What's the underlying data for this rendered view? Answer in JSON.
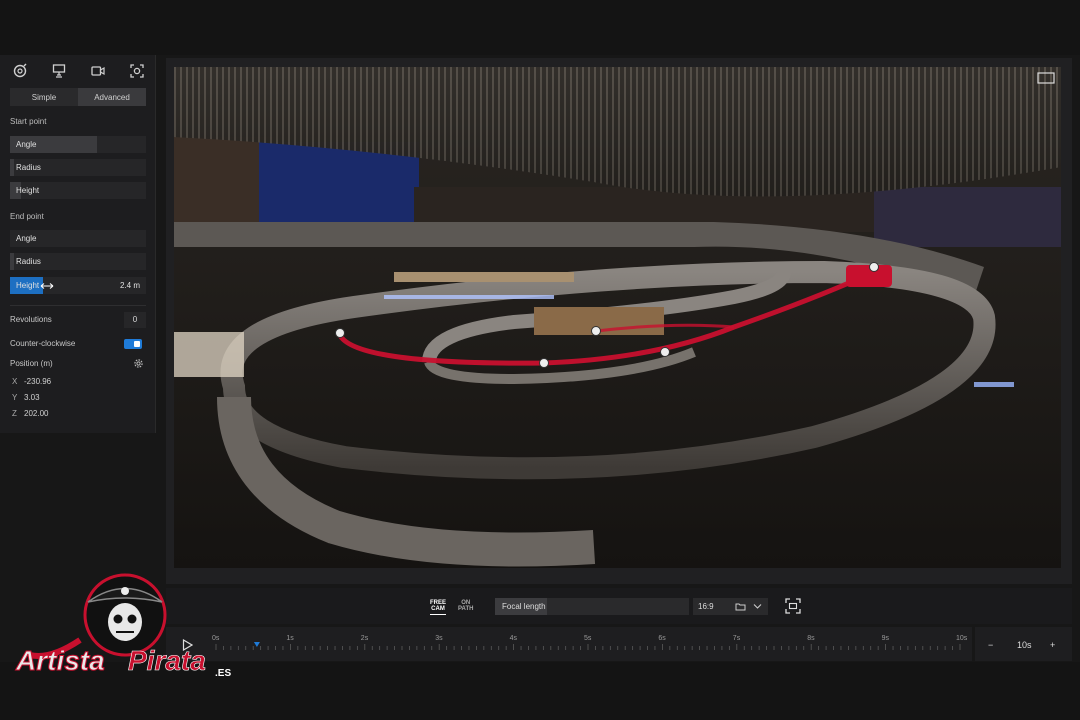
{
  "panel": {
    "icons": [
      "orbit-icon",
      "presentation-icon",
      "video-camera-icon",
      "screenshot-icon"
    ],
    "tabs": {
      "simple": "Simple",
      "advanced": "Advanced"
    },
    "start_point": {
      "label": "Start point",
      "angle": {
        "label": "Angle",
        "fill": 0.64
      },
      "radius": {
        "label": "Radius",
        "fill": 0.03
      },
      "height": {
        "label": "Height",
        "fill": 0.08
      }
    },
    "end_point": {
      "label": "End point",
      "angle": {
        "label": "Angle",
        "fill": 0.0
      },
      "radius": {
        "label": "Radius",
        "fill": 0.03
      },
      "height": {
        "label": "Height",
        "value": "2.4 m",
        "fill": 0.24
      }
    },
    "revolutions": {
      "label": "Revolutions",
      "value": "0"
    },
    "counter_clockwise": {
      "label": "Counter-clockwise",
      "on": true
    },
    "position": {
      "label": "Position (m)",
      "x": {
        "axis": "X",
        "value": "-230.96"
      },
      "y": {
        "axis": "Y",
        "value": "3.03"
      },
      "z": {
        "axis": "Z",
        "value": "202.00"
      }
    }
  },
  "toolbar": {
    "free_cam": [
      "FREE",
      "CAM"
    ],
    "on_path": [
      "ON",
      "PATH"
    ],
    "focal_length": "Focal length",
    "aspect_ratio": "16:9"
  },
  "timeline": {
    "ticks": [
      "0s",
      "1s",
      "2s",
      "3s",
      "4s",
      "5s",
      "6s",
      "7s",
      "8s",
      "9s",
      "10s"
    ],
    "playhead_fraction": 0.055,
    "duration": "10s",
    "minus": "−",
    "plus": "+"
  },
  "watermark": {
    "text_a": "Artista",
    "text_b": "Pirata",
    "suffix": ".ES"
  },
  "colors": {
    "accent": "#1f7bd8",
    "path": "#c8102e"
  }
}
